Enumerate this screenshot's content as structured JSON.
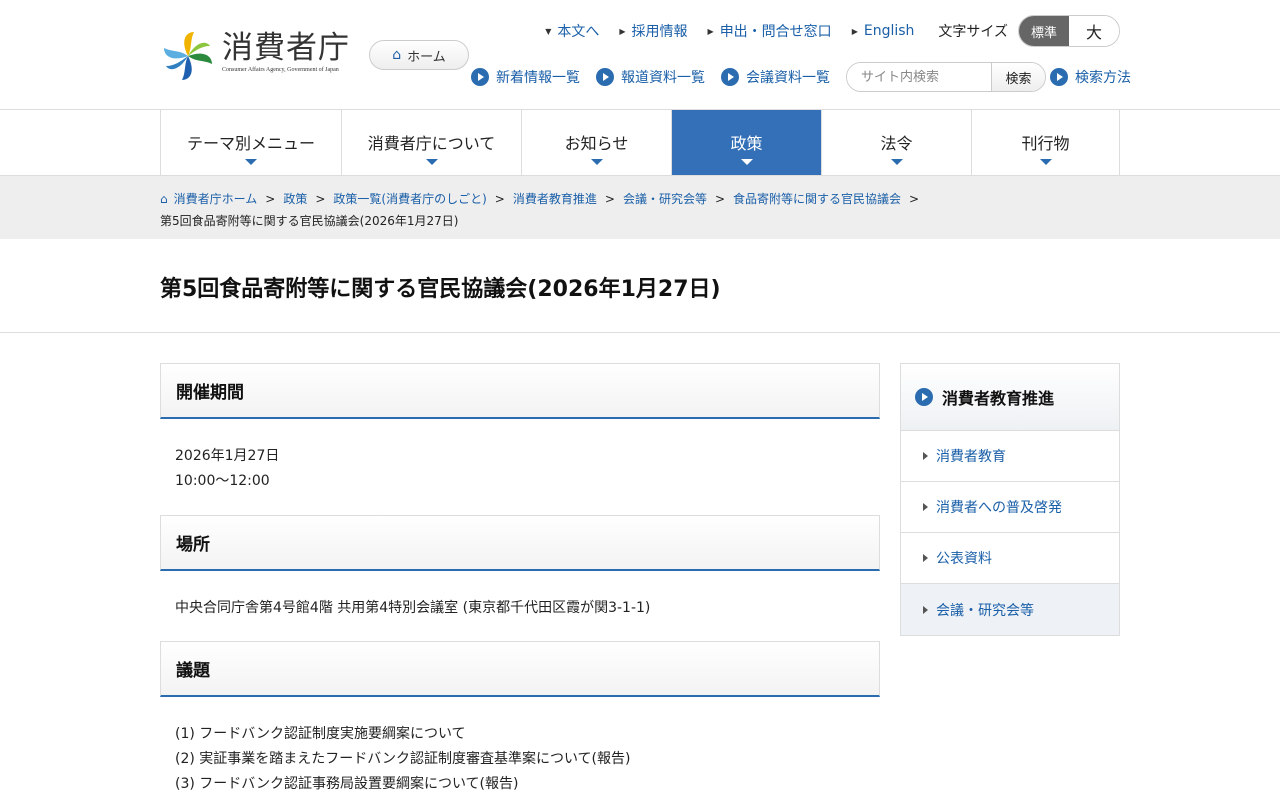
{
  "header": {
    "logo_title": "消費者庁",
    "logo_subtitle": "Consumer Affairs Agency, Government of Japan",
    "home_button": "ホーム",
    "util_links": [
      "本文へ",
      "採用情報",
      "申出・問合せ窓口",
      "English"
    ],
    "font_size_label": "文字サイズ",
    "font_size_standard": "標準",
    "font_size_large": "大",
    "quick_links": [
      "新着情報一覧",
      "報道資料一覧",
      "会議資料一覧"
    ],
    "search_placeholder": "サイト内検索",
    "search_button": "検索",
    "search_method": "検索方法"
  },
  "nav": {
    "items": [
      "テーマ別メニュー",
      "消費者庁について",
      "お知らせ",
      "政策",
      "法令",
      "刊行物"
    ],
    "active": "政策"
  },
  "breadcrumb": {
    "items": [
      "消費者庁ホーム",
      "政策",
      "政策一覧(消費者庁のしごと)",
      "消費者教育推進",
      "会議・研究会等",
      "食品寄附等に関する官民協議会"
    ],
    "current": "第5回食品寄附等に関する官民協議会(2026年1月27日)"
  },
  "page_title": "第5回食品寄附等に関する官民協議会(2026年1月27日)",
  "sections": {
    "period": {
      "heading": "開催期間",
      "date": "2026年1月27日",
      "time": "10:00～12:00"
    },
    "place": {
      "heading": "場所",
      "text": "中央合同庁舎第4号館4階 共用第4特別会議室 (東京都千代田区霞が関3-1-1)"
    },
    "agenda": {
      "heading": "議題",
      "items": [
        "(1) フードバンク認証制度実施要綱案について",
        "(2) 実証事業を踏まえたフードバンク認証制度審査基準案について(報告)",
        "(3) フードバンク認証事務局設置要綱案について(報告)"
      ]
    }
  },
  "sidebar": {
    "heading": "消費者教育推進",
    "items": [
      "消費者教育",
      "消費者への普及啓発",
      "公表資料",
      "会議・研究会等"
    ],
    "active": "会議・研究会等"
  },
  "colors": {
    "accent": "#3370b8",
    "link": "#1a5fa8"
  }
}
